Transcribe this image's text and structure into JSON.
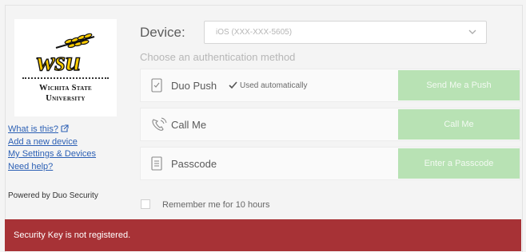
{
  "logo": {
    "university_line1": "Wichita State",
    "university_line2": "University"
  },
  "sidebar": {
    "links": [
      {
        "label": "What is this?"
      },
      {
        "label": "Add a new device"
      },
      {
        "label": "My Settings & Devices"
      },
      {
        "label": "Need help?"
      }
    ],
    "powered_by": "Powered by Duo Security"
  },
  "device": {
    "label": "Device:",
    "selected": "iOS (XXX-XXX-5605)"
  },
  "choose_text": "Choose an authentication method",
  "methods": [
    {
      "label": "Duo Push",
      "note": "Used automatically",
      "button": "Send Me a Push",
      "icon": "phone-push-icon"
    },
    {
      "label": "Call Me",
      "note": "",
      "button": "Call Me",
      "icon": "phone-call-icon"
    },
    {
      "label": "Passcode",
      "note": "",
      "button": "Enter a Passcode",
      "icon": "passcode-icon"
    }
  ],
  "remember": {
    "label": "Remember me for 10 hours"
  },
  "error": {
    "message": "Security Key is not registered."
  },
  "colors": {
    "accent_green": "#b8e2b4",
    "error_red": "#a73236",
    "link_blue": "#2b5fb4",
    "wsu_gold": "#ffcd00"
  }
}
